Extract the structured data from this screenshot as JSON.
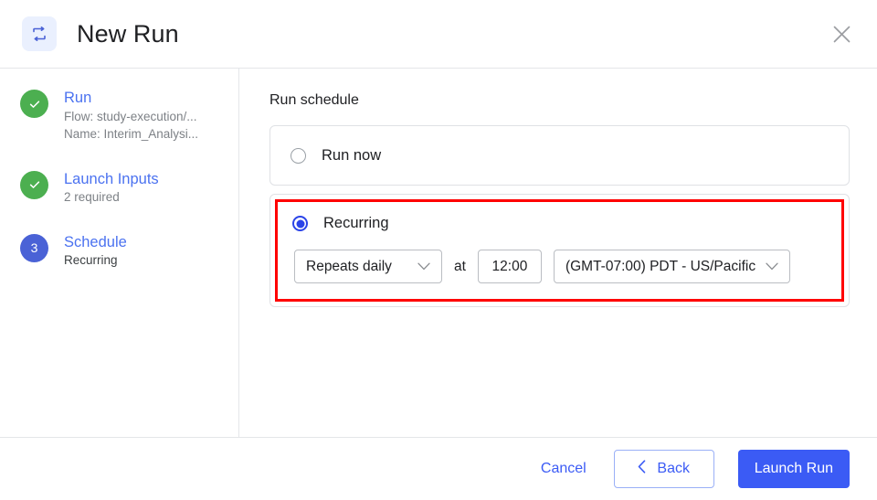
{
  "header": {
    "title": "New Run",
    "icon": "repeat-icon",
    "close_icon": "close-icon",
    "icon_bg": "#eaf0fe",
    "icon_color": "#4a62d6"
  },
  "sidebar": {
    "steps": [
      {
        "marker": "check-icon",
        "state": "done",
        "label": "Run",
        "sub1": "Flow: study-execution/...",
        "sub2": "Name: Interim_Analysi..."
      },
      {
        "marker": "check-icon",
        "state": "done",
        "label": "Launch Inputs",
        "sub1": "2 required",
        "sub2": ""
      },
      {
        "marker": "3",
        "state": "active",
        "label": "Schedule",
        "sub1": "Recurring",
        "sub2": ""
      }
    ]
  },
  "main": {
    "section_title": "Run schedule",
    "options": [
      {
        "label": "Run now",
        "selected": false
      },
      {
        "label": "Recurring",
        "selected": true
      }
    ],
    "recurring": {
      "repeat_select": "Repeats daily",
      "at_label": "at",
      "time_value": "12:00",
      "timezone_select": "(GMT-07:00) PDT - US/Pacific",
      "highlight_color": "#ff0000"
    }
  },
  "footer": {
    "cancel_label": "Cancel",
    "back_label": "Back",
    "back_icon": "chevron-left-icon",
    "launch_label": "Launch Run",
    "primary_color": "#3b5bf5"
  }
}
